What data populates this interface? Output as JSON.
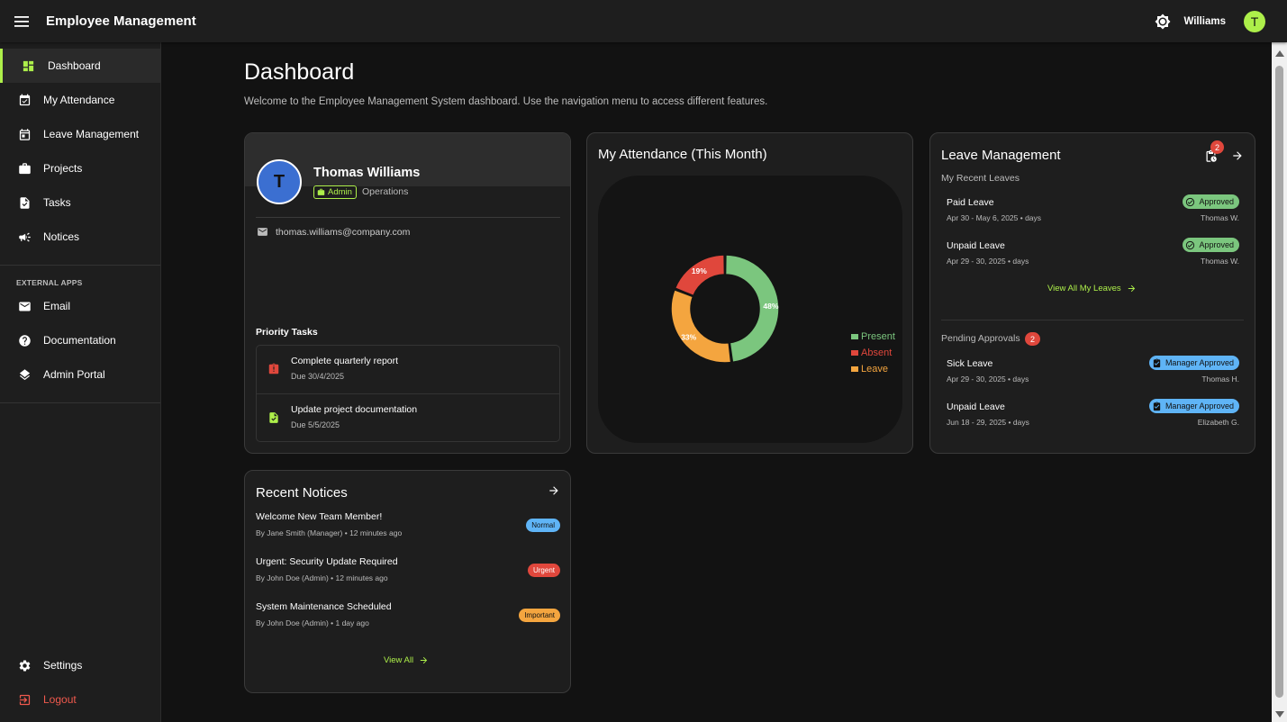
{
  "app": {
    "title": "Employee Management",
    "user_name": "Williams",
    "user_initial": "T"
  },
  "sidebar": {
    "items": [
      {
        "label": "Dashboard"
      },
      {
        "label": "My Attendance"
      },
      {
        "label": "Leave Management"
      },
      {
        "label": "Projects"
      },
      {
        "label": "Tasks"
      },
      {
        "label": "Notices"
      }
    ],
    "external_section": "EXTERNAL APPS",
    "external_items": [
      {
        "label": "Email"
      },
      {
        "label": "Documentation"
      },
      {
        "label": "Admin Portal"
      }
    ],
    "settings_label": "Settings",
    "logout_label": "Logout"
  },
  "page": {
    "title": "Dashboard",
    "subtitle": "Welcome to the Employee Management System dashboard. Use the navigation menu to access different features."
  },
  "profile": {
    "initial": "T",
    "name": "Thomas Williams",
    "role": "Admin",
    "department": "Operations",
    "email": "thomas.williams@company.com",
    "priority_title": "Priority Tasks",
    "tasks": [
      {
        "name": "Complete quarterly report",
        "due": "Due 30/4/2025"
      },
      {
        "name": "Update project documentation",
        "due": "Due 5/5/2025"
      }
    ]
  },
  "attendance": {
    "title": "My Attendance (This Month)"
  },
  "chart_data": {
    "type": "pie",
    "categories": [
      "Present",
      "Absent",
      "Leave"
    ],
    "values": [
      48,
      19,
      33
    ],
    "labels": [
      "48%",
      "19%",
      "33%"
    ],
    "colors": [
      "#7bc67e",
      "#e0473c",
      "#f4a53f"
    ],
    "legend_position": "right",
    "donut": true
  },
  "leave": {
    "title": "Leave Management",
    "badge_count": "2",
    "recent_title": "My Recent Leaves",
    "recent": [
      {
        "type": "Paid Leave",
        "dates": "Apr 30 - May 6, 2025 •  days",
        "status": "Approved",
        "by": "Thomas W."
      },
      {
        "type": "Unpaid Leave",
        "dates": "Apr 29 - 30, 2025 •  days",
        "status": "Approved",
        "by": "Thomas W."
      }
    ],
    "view_all_label": "View All My Leaves",
    "pending_title": "Pending Approvals",
    "pending_count": "2",
    "pending": [
      {
        "type": "Sick Leave",
        "dates": "Apr 29 - 30, 2025 •  days",
        "status": "Manager Approved",
        "by": "Thomas H."
      },
      {
        "type": "Unpaid Leave",
        "dates": "Jun 18 - 29, 2025 •  days",
        "status": "Manager Approved",
        "by": "Elizabeth G."
      }
    ]
  },
  "notices": {
    "title": "Recent Notices",
    "items": [
      {
        "title": "Welcome New Team Member!",
        "by": "By Jane Smith (Manager) • 12 minutes ago",
        "priority": "Normal",
        "color": "#5fb4f6"
      },
      {
        "title": "Urgent: Security Update Required",
        "by": "By John Doe (Admin) • 12 minutes ago",
        "priority": "Urgent",
        "color": "#e0473c"
      },
      {
        "title": "System Maintenance Scheduled",
        "by": "By John Doe (Admin) • 1 day ago",
        "priority": "Important",
        "color": "#f4a53f"
      }
    ],
    "view_all_label": "View All"
  },
  "colors": {
    "accent": "#adef4a",
    "danger": "#e0473c",
    "info": "#5fb4f6",
    "warning": "#f4a53f",
    "success": "#7bc67e"
  }
}
